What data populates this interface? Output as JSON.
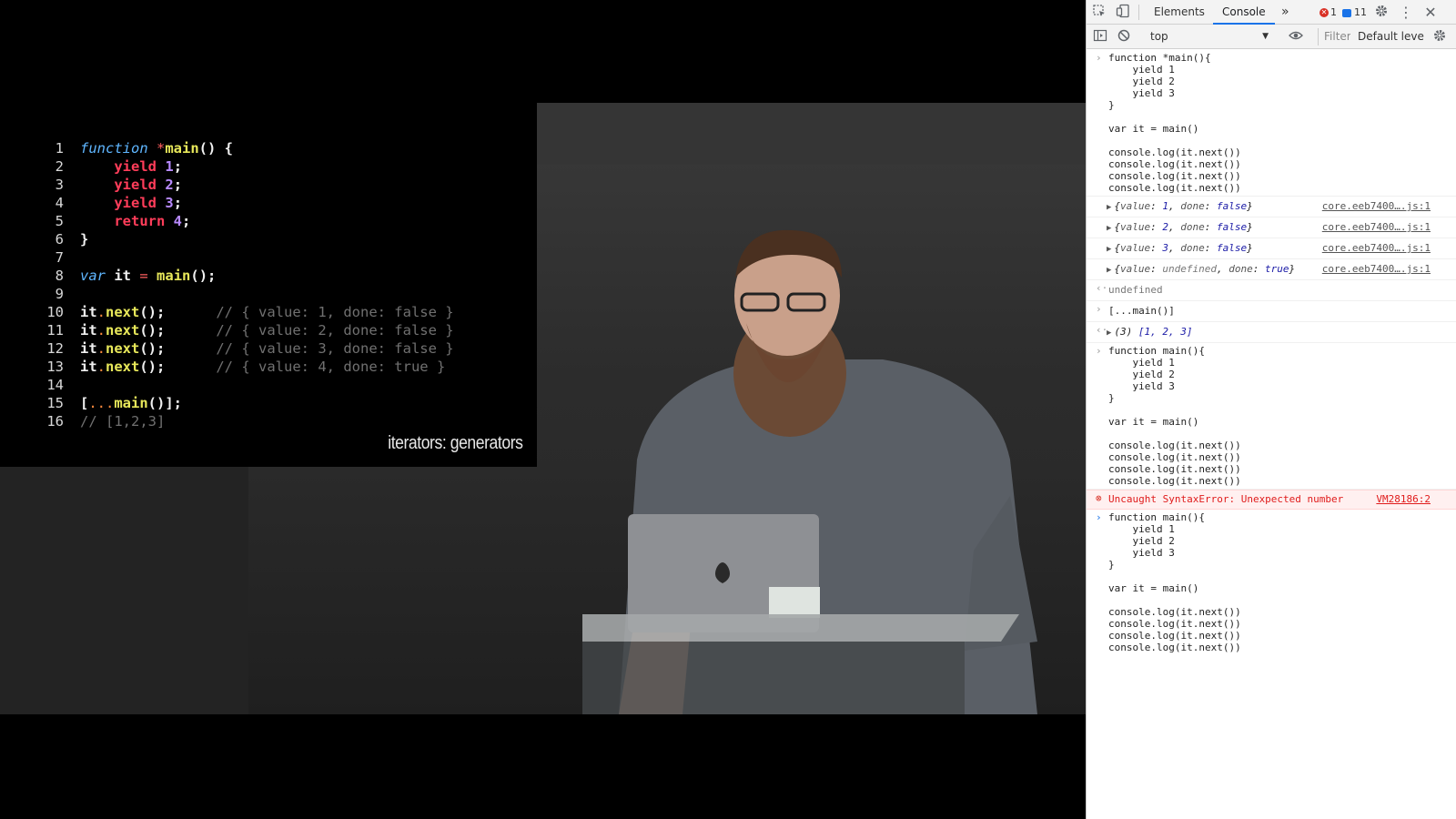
{
  "slide": {
    "lines": [
      {
        "n": "1"
      },
      {
        "n": "2"
      },
      {
        "n": "3"
      },
      {
        "n": "4"
      },
      {
        "n": "5"
      },
      {
        "n": "6"
      },
      {
        "n": "7"
      },
      {
        "n": "8"
      },
      {
        "n": "9"
      },
      {
        "n": "10"
      },
      {
        "n": "11"
      },
      {
        "n": "12"
      },
      {
        "n": "13"
      },
      {
        "n": "14"
      },
      {
        "n": "15"
      },
      {
        "n": "16"
      }
    ],
    "l1": {
      "kw": "function",
      "star": "*",
      "fn": "main",
      "rest": "() {"
    },
    "l2": {
      "kw": "yield",
      "num": "1",
      "end": ";"
    },
    "l3": {
      "kw": "yield",
      "num": "2",
      "end": ";"
    },
    "l4": {
      "kw": "yield",
      "num": "3",
      "end": ";"
    },
    "l5": {
      "kw": "return",
      "num": "4",
      "end": ";"
    },
    "l6": "}",
    "l8": {
      "kw": "var",
      "id": "it",
      "op": "=",
      "fn": "main",
      "end": "();"
    },
    "l10": {
      "id": "it",
      "dot": ".",
      "m": "next",
      "end": "();",
      "cmt": "// { value: 1, done: false }"
    },
    "l11": {
      "id": "it",
      "dot": ".",
      "m": "next",
      "end": "();",
      "cmt": "// { value: 2, done: false }"
    },
    "l12": {
      "id": "it",
      "dot": ".",
      "m": "next",
      "end": "();",
      "cmt": "// { value: 3, done: false }"
    },
    "l13": {
      "id": "it",
      "dot": ".",
      "m": "next",
      "end": "();",
      "cmt": "// { value: 4, done: true }"
    },
    "l15": {
      "open": "[",
      "spread": "...",
      "fn": "main",
      "end": "()];"
    },
    "l16": "// [1,2,3]",
    "caption": "iterators: generators"
  },
  "devtools": {
    "tabs": {
      "elements": "Elements",
      "console": "Console",
      "more": "»"
    },
    "errors": "1",
    "messages": "11",
    "context": "top",
    "filter_placeholder": "Filter",
    "levels": "Default leve",
    "block1": [
      "function *main(){",
      "    yield 1",
      "    yield 2",
      "    yield 3",
      "}",
      "",
      "var it = main()",
      "",
      "console.log(it.next())",
      "console.log(it.next())",
      "console.log(it.next())",
      "console.log(it.next())"
    ],
    "objs": [
      {
        "k1": "value",
        "v1": "1",
        "k2": "done",
        "v2": "false",
        "src": "core.eeb7400….js:1"
      },
      {
        "k1": "value",
        "v1": "2",
        "k2": "done",
        "v2": "false",
        "src": "core.eeb7400….js:1"
      },
      {
        "k1": "value",
        "v1": "3",
        "k2": "done",
        "v2": "false",
        "src": "core.eeb7400….js:1"
      },
      {
        "k1": "value",
        "v1": "undefined",
        "k2": "done",
        "v2": "true",
        "src": "core.eeb7400….js:1"
      }
    ],
    "ret_undefined": "undefined",
    "spread_input": "[...main()]",
    "spread_result": {
      "count": "(3)",
      "arr": "[1, 2, 3]"
    },
    "block2": [
      "function main(){",
      "    yield 1",
      "    yield 2",
      "    yield 3",
      "}",
      "",
      "var it = main()",
      "",
      "console.log(it.next())",
      "console.log(it.next())",
      "console.log(it.next())",
      "console.log(it.next())"
    ],
    "error": {
      "text": "Uncaught SyntaxError: Unexpected number",
      "src": "VM28186:2"
    },
    "block3": [
      "function main(){",
      "    yield 1",
      "    yield 2",
      "    yield 3",
      "}",
      "",
      "var it = main()",
      "",
      "console.log(it.next())",
      "console.log(it.next())",
      "console.log(it.next())",
      "console.log(it.next())"
    ]
  }
}
